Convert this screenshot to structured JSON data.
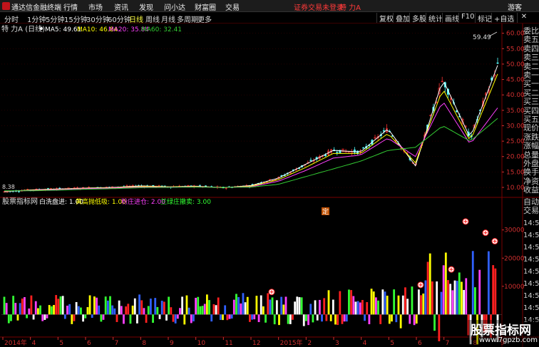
{
  "window": {
    "app_name": "通达信金融终端",
    "menus": [
      "行情",
      "市场",
      "资讯",
      "发现",
      "问小达",
      "财富圈",
      "交易"
    ],
    "login_warning": "证券交易未登录",
    "stock_title": "特 力A",
    "guest_label": "游客"
  },
  "toolbar": {
    "periods": [
      "分时",
      "1分钟",
      "5分钟",
      "15分钟",
      "30分钟",
      "60分钟",
      "日线",
      "周线",
      "月线",
      "多周期",
      "更多"
    ],
    "active_period": "日线",
    "buttons": [
      "复权",
      "叠加",
      "多股",
      "统计",
      "画线",
      "F10",
      "标记",
      "+自选"
    ]
  },
  "main_chart": {
    "stock_label": "特 力A (日线)",
    "ma5_label": "MA5: 49.61",
    "ma10_label": "MA10: 46.84",
    "ma20_label": "MA20: 35.84",
    "ma60_label": "MA60: 32.41",
    "high_callout": "59.49",
    "low_callout": "8.38",
    "marker_label": "定"
  },
  "indicator": {
    "name": "股票指标网",
    "items": [
      {
        "label": "白洗盘进: 1.00",
        "color": "#ffffff"
      },
      {
        "label": "黄高抛低吸: 1.00",
        "color": "#ffff00"
      },
      {
        "label": "粉庄进仓: 2.00",
        "color": "#ff40ff"
      },
      {
        "label": "兰绿庄撤卖: 3.00",
        "color": "#33ff33"
      }
    ]
  },
  "side_panel": {
    "items": [
      "委比",
      "卖五",
      "卖四",
      "卖三",
      "卖二",
      "卖一",
      "买一",
      "买二",
      "买三",
      "买四",
      "买五",
      "现价",
      "涨跌",
      "涨幅",
      "总量",
      "外盘",
      "换手",
      "净资",
      "收益"
    ],
    "trade_label": "自动交易",
    "times": [
      "14:50",
      "14:50",
      "14:50",
      "14:50",
      "14:50",
      "14:50",
      "14:50",
      "14:50",
      "14:50"
    ]
  },
  "x_axis": {
    "labels": [
      "2014年",
      "4",
      "5",
      "6",
      "7",
      "8",
      "9",
      "10",
      "11",
      "12",
      "2015年",
      "2",
      "3",
      "4",
      "5",
      "6",
      "7",
      "8",
      "9"
    ]
  },
  "watermark": {
    "title": "股票指标网",
    "url": "www.7gpzb.com"
  },
  "colors": {
    "up": "#ff3232",
    "down": "#54ffff",
    "ma5": "#ffffff",
    "ma10": "#ffff00",
    "ma20": "#ff40ff",
    "ma60": "#33cc33",
    "grid": "#7a0000",
    "axis_text": "#d03030"
  },
  "chart_data": {
    "type": "line",
    "title": "特 力A (日线)",
    "price_axis": {
      "ticks": [
        10,
        15,
        20,
        25,
        30,
        35,
        40,
        45,
        50,
        55,
        60
      ],
      "ylim": [
        7,
        62
      ]
    },
    "indicator_axis": {
      "ticks": [
        10000,
        20000,
        30000
      ],
      "ylim": [
        -8000,
        36000
      ]
    },
    "x": [
      "2014年",
      "4",
      "5",
      "6",
      "7",
      "8",
      "9",
      "10",
      "11",
      "12",
      "2015年",
      "2",
      "3",
      "4",
      "5",
      "6",
      "7",
      "8",
      "9"
    ],
    "series": [
      {
        "name": "MA5",
        "values": [
          8.6,
          9.2,
          9.5,
          9.8,
          10,
          10.5,
          10.2,
          10.4,
          9.9,
          10.6,
          13,
          17.5,
          22,
          21.5,
          29,
          17,
          45,
          26,
          49.6
        ]
      },
      {
        "name": "MA10",
        "values": [
          8.7,
          9.1,
          9.4,
          9.7,
          9.9,
          10.3,
          10.2,
          10.3,
          9.95,
          10.4,
          12.5,
          16.5,
          21,
          21,
          27.5,
          18,
          42,
          25,
          46.8
        ]
      },
      {
        "name": "MA20",
        "values": [
          8.8,
          9,
          9.3,
          9.6,
          9.8,
          10.1,
          10.1,
          10.2,
          10,
          10.2,
          12,
          15.5,
          19.5,
          20.5,
          26,
          20,
          38,
          24,
          35.8
        ]
      },
      {
        "name": "MA60",
        "values": [
          8.9,
          8.9,
          9.1,
          9.4,
          9.6,
          9.9,
          10,
          10.1,
          10,
          10.1,
          11,
          13.5,
          16,
          18.5,
          22,
          23,
          30,
          25,
          32.4
        ]
      }
    ],
    "annotations": [
      "59.49",
      "8.38",
      "定"
    ]
  }
}
